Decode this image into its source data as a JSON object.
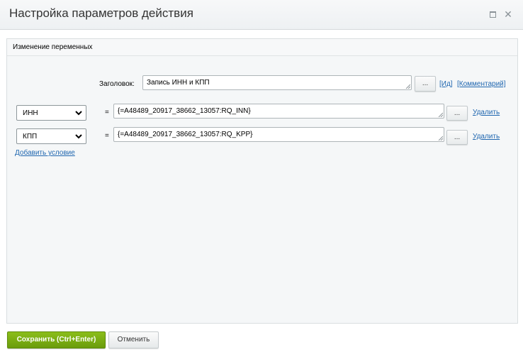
{
  "dialog": {
    "title": "Настройка параметров действия",
    "maximize_icon": "maximize-icon",
    "close_icon": "close-icon"
  },
  "section": {
    "title": "Изменение переменных"
  },
  "header_row": {
    "label": "Заголовок:",
    "value": "Запись ИНН и КПП",
    "dots_label": "...",
    "id_link": "[Ид]",
    "comment_link": "[Комментарий]"
  },
  "conditions": [
    {
      "variable": "ИНН",
      "operator": "=",
      "value": "{=A48489_20917_38662_13057:RQ_INN}",
      "dots_label": "...",
      "delete_label": "Удалить"
    },
    {
      "variable": "КПП",
      "operator": "=",
      "value": "{=A48489_20917_38662_13057:RQ_KPP}",
      "dots_label": "...",
      "delete_label": "Удалить"
    }
  ],
  "add_condition_label": "Добавить условие",
  "footer": {
    "save_label": "Сохранить (Ctrl+Enter)",
    "cancel_label": "Отменить"
  },
  "colors": {
    "save_button": "#7aad14",
    "link": "#2067b0",
    "panel_background": "#f5f7f8"
  }
}
